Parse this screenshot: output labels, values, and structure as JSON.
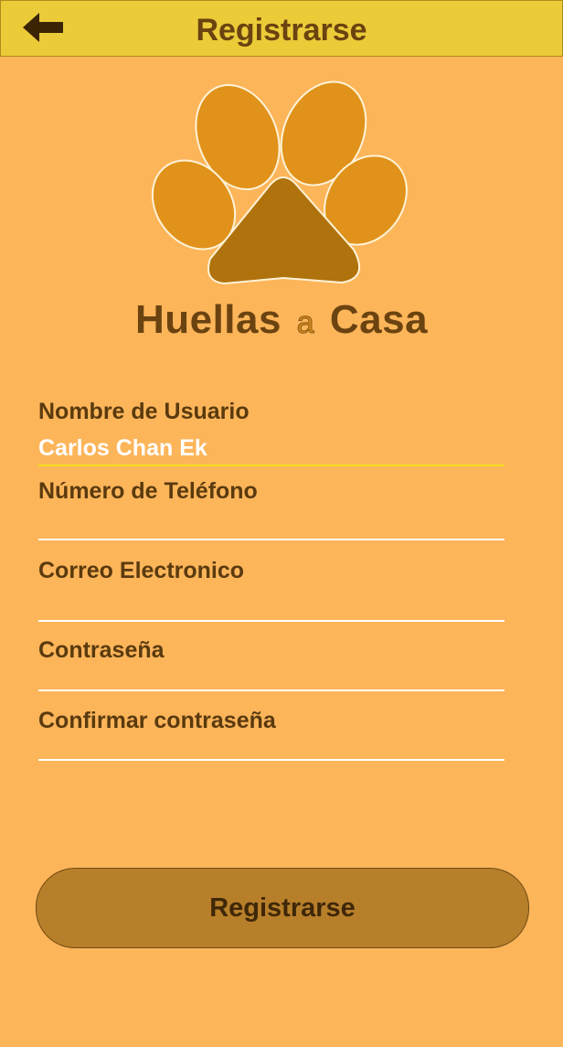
{
  "header": {
    "title": "Registrarse",
    "back_icon": "arrow-left-icon"
  },
  "logo": {
    "brand_part1": "Huellas",
    "brand_connector": "a",
    "brand_part2": "Casa",
    "icon": "paw-icon"
  },
  "form": {
    "username": {
      "label": "Nombre de Usuario",
      "value": "Carlos Chan Ek"
    },
    "phone": {
      "label": "Número de Teléfono",
      "value": ""
    },
    "email": {
      "label": "Correo Electronico",
      "value": ""
    },
    "password": {
      "label": "Contraseña",
      "value": ""
    },
    "confirm_password": {
      "label": "Confirmar contraseña",
      "value": ""
    }
  },
  "submit": {
    "label": "Registrarse"
  },
  "colors": {
    "background": "#FDB55A",
    "header": "#EBCB38",
    "button": "#B87F2A",
    "text": "#5A3A0E",
    "focus_line": "#F2DE1E"
  }
}
